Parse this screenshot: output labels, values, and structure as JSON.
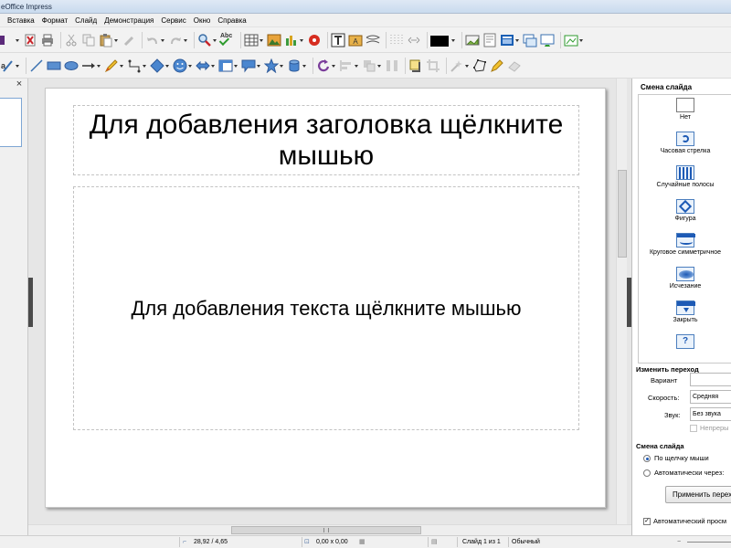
{
  "window": {
    "title": "eOffice Impress"
  },
  "menu": {
    "items": [
      "Вставка",
      "Формат",
      "Слайд",
      "Демонстрация",
      "Сервис",
      "Окно",
      "Справка"
    ]
  },
  "toolbar1": {
    "icons": [
      "save-dropdown-icon",
      "export-pdf-icon",
      "print-icon",
      "cut-icon",
      "copy-icon",
      "paste-icon",
      "clone-formatting-icon",
      "undo-icon",
      "redo-icon",
      "find-replace-icon",
      "spellcheck-icon",
      "table-icon",
      "image-icon",
      "chart-icon",
      "media-icon",
      "text-box-icon",
      "fontwork-gallery-icon",
      "connector-icon",
      "grid-icon",
      "navigator-icon",
      "slide-show-icon",
      "slide-icon",
      "slide-layout-icon",
      "new-slide-icon",
      "duplicate-slide-icon",
      "display-views-icon",
      "insert-image-icon"
    ],
    "line_color": "#000000"
  },
  "toolbar2": {
    "icons": [
      "text-tool-icon",
      "line-icon",
      "rectangle-icon",
      "ellipse-icon",
      "arrow-icon",
      "pencil-icon",
      "connector-tool-icon",
      "diamond-icon",
      "smiley-icon",
      "double-arrow-icon",
      "flowchart-icon",
      "callout-icon",
      "star-icon",
      "cylinder-icon",
      "rotate-icon",
      "align-icon",
      "arrange-icon",
      "distribute-icon",
      "shadow-icon",
      "crop-icon",
      "filter-icon",
      "points-icon",
      "fontwork-icon",
      "extrusion-icon"
    ]
  },
  "slide_pane": {
    "close_symbol": "×"
  },
  "slide": {
    "title_placeholder": "Для добавления заголовка щёлкните мышью",
    "body_placeholder": "Для добавления текста щёлкните мышью"
  },
  "transition_panel": {
    "title": "Смена слайда",
    "effects": [
      {
        "label": "Нет",
        "icon": "none-transition-icon"
      },
      {
        "label": "Часовая стрелка",
        "icon": "clockwise-transition-icon"
      },
      {
        "label": "Случайные полосы",
        "icon": "random-bars-transition-icon"
      },
      {
        "label": "Фигура",
        "icon": "shape-transition-icon"
      },
      {
        "label": "Круговое симметричное",
        "icon": "circular-symmetric-transition-icon"
      },
      {
        "label": "Исчезание",
        "icon": "fade-transition-icon"
      },
      {
        "label": "Закрыть",
        "icon": "close-transition-icon"
      },
      {
        "label": "",
        "icon": "unknown-transition-icon",
        "glyph": "?"
      }
    ],
    "modify_heading": "Изменить переход",
    "variant_label": "Вариант",
    "variant_value": "",
    "speed_label": "Скорость:",
    "speed_value": "Средняя",
    "sound_label": "Звук:",
    "sound_value": "Без звука",
    "loop_label": "Непреры",
    "advance_heading": "Смена слайда",
    "on_click_label": "По щелчку мыши",
    "auto_label": "Автоматически через:",
    "apply_button": "Применить переход",
    "autopreview_label": "Автоматический просм"
  },
  "statusbar": {
    "position": "28,92 / 4,65",
    "size": "0,00 x 0,00",
    "slide_counter": "Слайд 1 из 1",
    "layout": "Обычный"
  }
}
